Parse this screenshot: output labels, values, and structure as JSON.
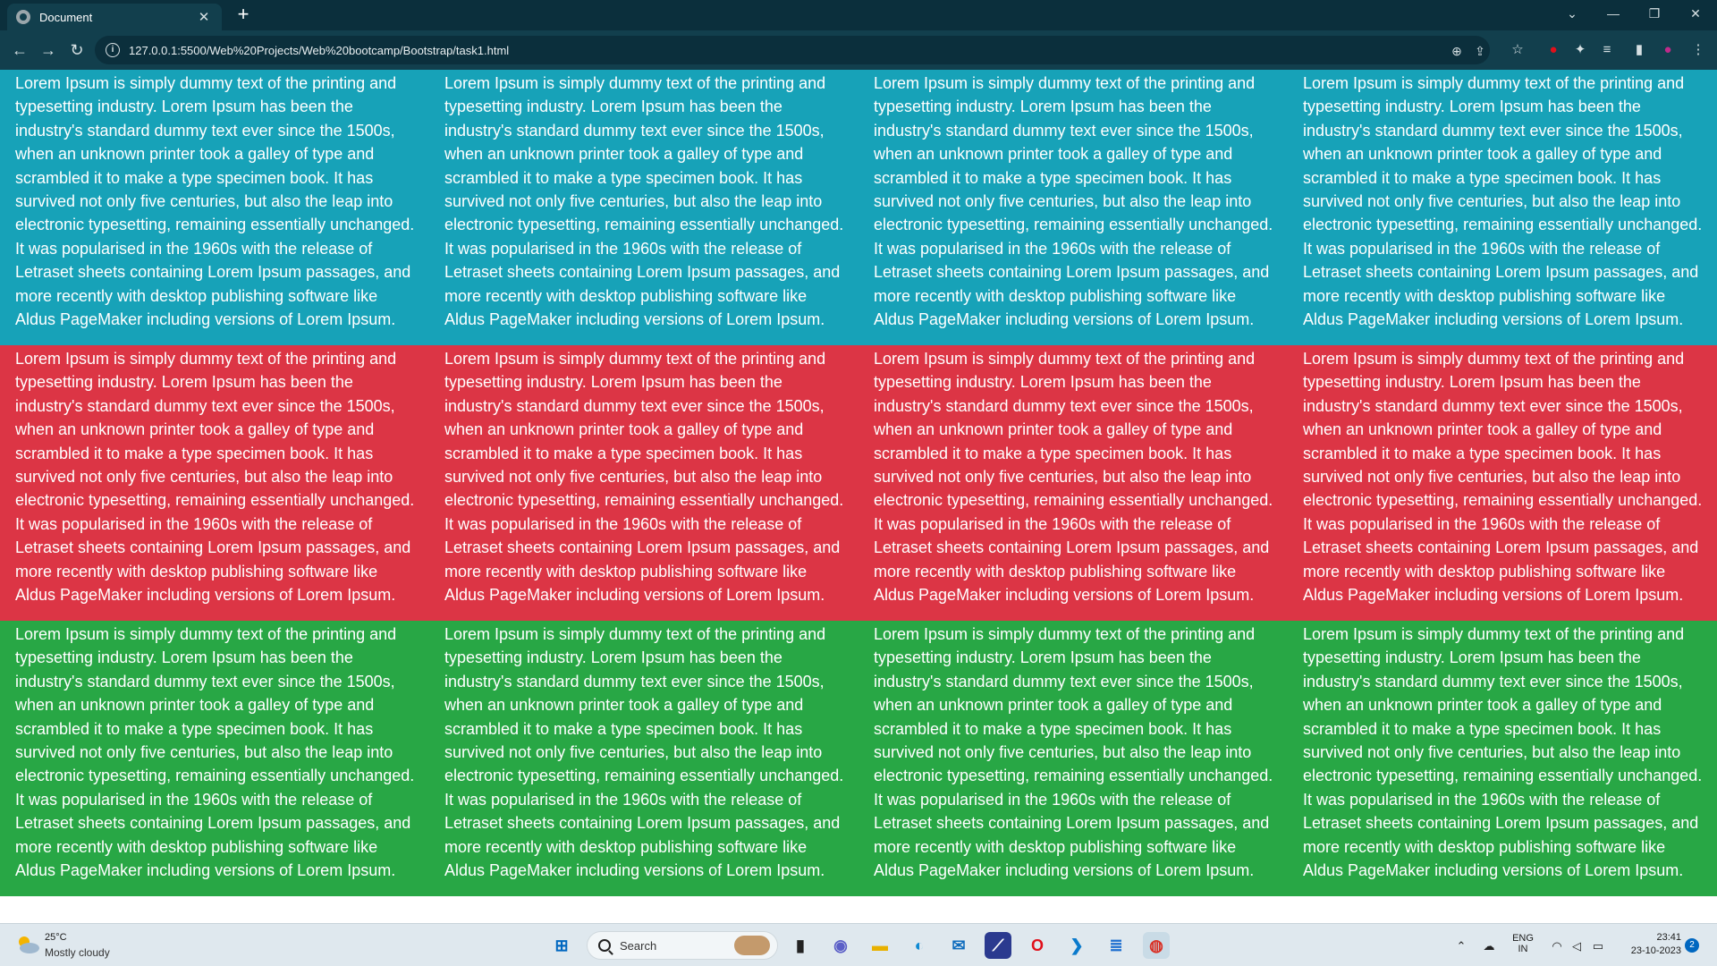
{
  "browser": {
    "tab_title": "Document",
    "tab_close": "✕",
    "new_tab": "+",
    "url": "127.0.0.1:5500/Web%20Projects/Web%20bootcamp/Bootstrap/task1.html",
    "controls": {
      "menu": "⌄",
      "minimize": "—",
      "restore": "❐",
      "close": "✕"
    },
    "nav": {
      "back": "←",
      "forward": "→",
      "reload": "↻"
    },
    "omni_icons": {
      "zoom": "⊕",
      "share": "⇪",
      "bookmark": "☆"
    },
    "extensions": {
      "opera": "●",
      "puzzle": "✦",
      "media": "≡",
      "sidepanel": "▮",
      "profile": "●",
      "menu": "⋮"
    }
  },
  "page": {
    "rows": [
      {
        "name": "info",
        "color": "#17a2b8",
        "columns": [
          "Lorem Ipsum is simply dummy text of the printing and typesetting industry. Lorem Ipsum has been the industry's standard dummy text ever since the 1500s, when an unknown printer took a galley of type and scrambled it to make a type specimen book. It has survived not only five centuries, but also the leap into electronic typesetting, remaining essentially unchanged. It was popularised in the 1960s with the release of Letraset sheets containing Lorem Ipsum passages, and more recently with desktop publishing software like Aldus PageMaker including versions of Lorem Ipsum.",
          "Lorem Ipsum is simply dummy text of the printing and typesetting industry. Lorem Ipsum has been the industry's standard dummy text ever since the 1500s, when an unknown printer took a galley of type and scrambled it to make a type specimen book. It has survived not only five centuries, but also the leap into electronic typesetting, remaining essentially unchanged. It was popularised in the 1960s with the release of Letraset sheets containing Lorem Ipsum passages, and more recently with desktop publishing software like Aldus PageMaker including versions of Lorem Ipsum.",
          "Lorem Ipsum is simply dummy text of the printing and typesetting industry. Lorem Ipsum has been the industry's standard dummy text ever since the 1500s, when an unknown printer took a galley of type and scrambled it to make a type specimen book. It has survived not only five centuries, but also the leap into electronic typesetting, remaining essentially unchanged. It was popularised in the 1960s with the release of Letraset sheets containing Lorem Ipsum passages, and more recently with desktop publishing software like Aldus PageMaker including versions of Lorem Ipsum.",
          "Lorem Ipsum is simply dummy text of the printing and typesetting industry. Lorem Ipsum has been the industry's standard dummy text ever since the 1500s, when an unknown printer took a galley of type and scrambled it to make a type specimen book. It has survived not only five centuries, but also the leap into electronic typesetting, remaining essentially unchanged. It was popularised in the 1960s with the release of Letraset sheets containing Lorem Ipsum passages, and more recently with desktop publishing software like Aldus PageMaker including versions of Lorem Ipsum."
        ]
      },
      {
        "name": "danger",
        "color": "#dc3545",
        "columns": [
          "Lorem Ipsum is simply dummy text of the printing and typesetting industry. Lorem Ipsum has been the industry's standard dummy text ever since the 1500s, when an unknown printer took a galley of type and scrambled it to make a type specimen book. It has survived not only five centuries, but also the leap into electronic typesetting, remaining essentially unchanged. It was popularised in the 1960s with the release of Letraset sheets containing Lorem Ipsum passages, and more recently with desktop publishing software like Aldus PageMaker including versions of Lorem Ipsum.",
          "Lorem Ipsum is simply dummy text of the printing and typesetting industry. Lorem Ipsum has been the industry's standard dummy text ever since the 1500s, when an unknown printer took a galley of type and scrambled it to make a type specimen book. It has survived not only five centuries, but also the leap into electronic typesetting, remaining essentially unchanged. It was popularised in the 1960s with the release of Letraset sheets containing Lorem Ipsum passages, and more recently with desktop publishing software like Aldus PageMaker including versions of Lorem Ipsum.",
          "Lorem Ipsum is simply dummy text of the printing and typesetting industry. Lorem Ipsum has been the industry's standard dummy text ever since the 1500s, when an unknown printer took a galley of type and scrambled it to make a type specimen book. It has survived not only five centuries, but also the leap into electronic typesetting, remaining essentially unchanged. It was popularised in the 1960s with the release of Letraset sheets containing Lorem Ipsum passages, and more recently with desktop publishing software like Aldus PageMaker including versions of Lorem Ipsum.",
          "Lorem Ipsum is simply dummy text of the printing and typesetting industry. Lorem Ipsum has been the industry's standard dummy text ever since the 1500s, when an unknown printer took a galley of type and scrambled it to make a type specimen book. It has survived not only five centuries, but also the leap into electronic typesetting, remaining essentially unchanged. It was popularised in the 1960s with the release of Letraset sheets containing Lorem Ipsum passages, and more recently with desktop publishing software like Aldus PageMaker including versions of Lorem Ipsum."
        ]
      },
      {
        "name": "success",
        "color": "#28a745",
        "columns": [
          "Lorem Ipsum is simply dummy text of the printing and typesetting industry. Lorem Ipsum has been the industry's standard dummy text ever since the 1500s, when an unknown printer took a galley of type and scrambled it to make a type specimen book. It has survived not only five centuries, but also the leap into electronic typesetting, remaining essentially unchanged. It was popularised in the 1960s with the release of Letraset sheets containing Lorem Ipsum passages, and more recently with desktop publishing software like Aldus PageMaker including versions of Lorem Ipsum.",
          "Lorem Ipsum is simply dummy text of the printing and typesetting industry. Lorem Ipsum has been the industry's standard dummy text ever since the 1500s, when an unknown printer took a galley of type and scrambled it to make a type specimen book. It has survived not only five centuries, but also the leap into electronic typesetting, remaining essentially unchanged. It was popularised in the 1960s with the release of Letraset sheets containing Lorem Ipsum passages, and more recently with desktop publishing software like Aldus PageMaker including versions of Lorem Ipsum.",
          "Lorem Ipsum is simply dummy text of the printing and typesetting industry. Lorem Ipsum has been the industry's standard dummy text ever since the 1500s, when an unknown printer took a galley of type and scrambled it to make a type specimen book. It has survived not only five centuries, but also the leap into electronic typesetting, remaining essentially unchanged. It was popularised in the 1960s with the release of Letraset sheets containing Lorem Ipsum passages, and more recently with desktop publishing software like Aldus PageMaker including versions of Lorem Ipsum.",
          "Lorem Ipsum is simply dummy text of the printing and typesetting industry. Lorem Ipsum has been the industry's standard dummy text ever since the 1500s, when an unknown printer took a galley of type and scrambled it to make a type specimen book. It has survived not only five centuries, but also the leap into electronic typesetting, remaining essentially unchanged. It was popularised in the 1960s with the release of Letraset sheets containing Lorem Ipsum passages, and more recently with desktop publishing software like Aldus PageMaker including versions of Lorem Ipsum."
        ]
      }
    ]
  },
  "taskbar": {
    "weather_temp": "25°C",
    "weather_desc": "Mostly cloudy",
    "search_label": "Search",
    "apps": [
      {
        "name": "start-icon",
        "glyph": "⊞",
        "color": "#0067c0",
        "bg": "transparent"
      },
      {
        "name": "task-view-icon",
        "glyph": "▮",
        "color": "#222222",
        "bg": "transparent"
      },
      {
        "name": "teams-chat-icon",
        "glyph": "◉",
        "color": "#5b5fc7",
        "bg": "transparent"
      },
      {
        "name": "file-explorer-icon",
        "glyph": "▬",
        "color": "#e8b100",
        "bg": "transparent"
      },
      {
        "name": "edge-icon",
        "glyph": "◐",
        "color": "#0f8ad3",
        "bg": "transparent"
      },
      {
        "name": "mail-icon",
        "glyph": "✉",
        "color": "#0f6cbd",
        "bg": "transparent"
      },
      {
        "name": "vscode-insiders-icon",
        "glyph": "⟋",
        "color": "#ffffff",
        "bg": "#2b3a8f"
      },
      {
        "name": "opera-icon",
        "glyph": "O",
        "color": "#e0101b",
        "bg": "transparent"
      },
      {
        "name": "vscode-icon",
        "glyph": "❯",
        "color": "#0a7acc",
        "bg": "transparent"
      },
      {
        "name": "notepad-icon",
        "glyph": "≣",
        "color": "#1e6fd0",
        "bg": "transparent"
      },
      {
        "name": "chrome-icon",
        "glyph": "◍",
        "color": "#d93025",
        "bg": "#c9dbe6"
      }
    ],
    "tray": {
      "chevron": "⌃",
      "onedrive": "☁",
      "language_top": "ENG",
      "language_bottom": "IN",
      "wifi": "◠",
      "volume": "◁",
      "battery": "▭",
      "time": "23:41",
      "date": "23-10-2023",
      "notifications": "2"
    }
  }
}
